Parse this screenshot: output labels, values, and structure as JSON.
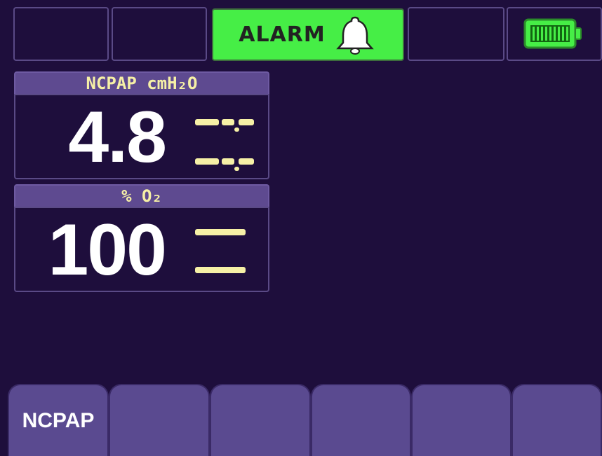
{
  "status_bar": {
    "alarm_label": "ALARM",
    "alarm_color": "#46ee46",
    "alarm_icon": "bell-icon",
    "battery_icon": "battery-full-icon",
    "battery_color": "#46ee46"
  },
  "params": [
    {
      "label": "NCPAP cmH₂O",
      "value": "4.8",
      "limit_indicator": "dashes"
    },
    {
      "label": "% O₂",
      "value": "100",
      "limit_indicator": "dashes"
    }
  ],
  "softkeys": [
    {
      "label": "NCPAP"
    },
    {
      "label": ""
    },
    {
      "label": ""
    },
    {
      "label": ""
    },
    {
      "label": ""
    },
    {
      "label": ""
    }
  ],
  "colors": {
    "background": "#1e0e3c",
    "panel_header": "#5e4a90",
    "label_text": "#f6f0a6",
    "value_text": "#ffffff",
    "softkey": "#5a4a90"
  }
}
